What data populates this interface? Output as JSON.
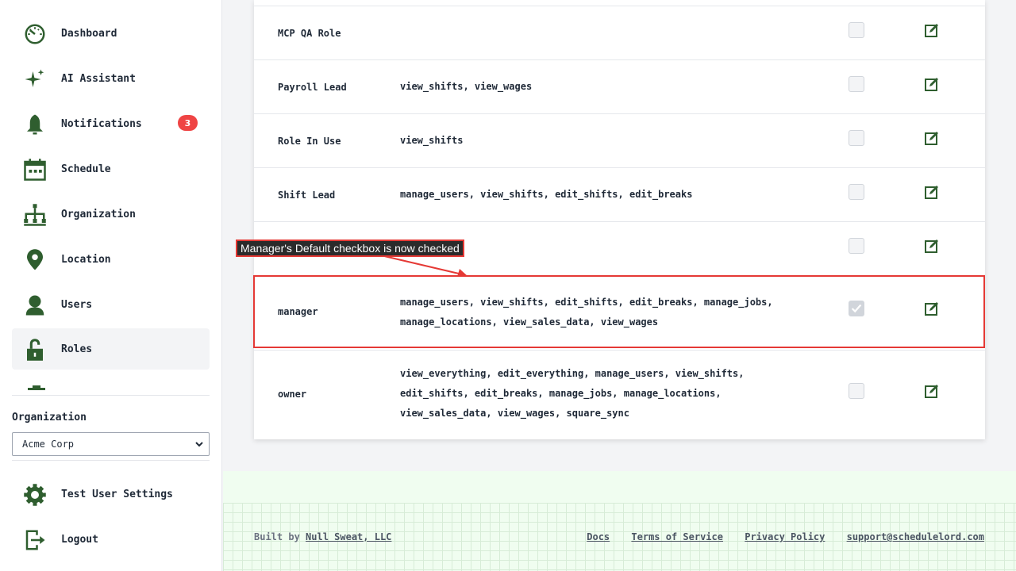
{
  "sidebar": {
    "items": [
      {
        "label": "Dashboard",
        "icon": "dashboard-icon"
      },
      {
        "label": "AI Assistant",
        "icon": "sparkle-icon"
      },
      {
        "label": "Notifications",
        "icon": "bell-icon",
        "badge": "3"
      },
      {
        "label": "Schedule",
        "icon": "calendar-icon"
      },
      {
        "label": "Organization",
        "icon": "org-chart-icon"
      },
      {
        "label": "Location",
        "icon": "location-pin-icon"
      },
      {
        "label": "Users",
        "icon": "user-icon"
      },
      {
        "label": "Roles",
        "icon": "unlock-icon",
        "active": true
      }
    ],
    "org_label": "Organization",
    "org_selected": "Acme Corp",
    "bottom_items": [
      {
        "label": "Test User Settings",
        "icon": "gear-icon"
      },
      {
        "label": "Logout",
        "icon": "logout-icon"
      }
    ]
  },
  "roles": [
    {
      "name": "MCP QA Role",
      "permissions": "",
      "default_checked": false
    },
    {
      "name": "Payroll Lead",
      "permissions": "view_shifts, view_wages",
      "default_checked": false
    },
    {
      "name": "Role In Use",
      "permissions": "view_shifts",
      "default_checked": false
    },
    {
      "name": "Shift Lead",
      "permissions": "manage_users, view_shifts, edit_shifts, edit_breaks",
      "default_checked": false
    },
    {
      "name": "",
      "permissions": "",
      "default_checked": false
    },
    {
      "name": "manager",
      "permissions": "manage_users, view_shifts, edit_shifts, edit_breaks, manage_jobs, manage_locations, view_sales_data, view_wages",
      "default_checked": true
    },
    {
      "name": "owner",
      "permissions": "view_everything, edit_everything, manage_users, view_shifts, edit_shifts, edit_breaks, manage_jobs, manage_locations, view_sales_data, view_wages, square_sync",
      "default_checked": false
    }
  ],
  "annotation": {
    "text": "Manager's Default checkbox is now checked",
    "color": "#e53935"
  },
  "footer": {
    "built_by_prefix": "Built by ",
    "built_by_link": "Null Sweat, LLC",
    "links": [
      "Docs",
      "Terms of Service",
      "Privacy Policy",
      "support@schedulelord.com"
    ]
  },
  "colors": {
    "icon_green": "#2f5e2f",
    "badge_red": "#ef4444",
    "highlight_red": "#e53935"
  }
}
